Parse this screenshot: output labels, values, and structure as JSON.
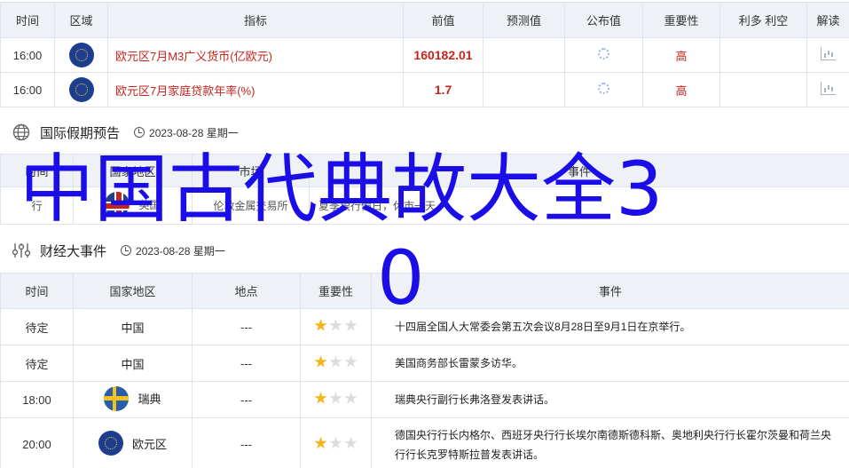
{
  "eco": {
    "headers": [
      "时间",
      "区域",
      "指标",
      "前值",
      "预测值",
      "公布值",
      "重要性",
      "利多 利空",
      "解读"
    ],
    "rows": [
      {
        "time": "16:00",
        "region_flag": "eu",
        "indicator": "欧元区7月M3广义货币(亿欧元)",
        "previous": "160182.01",
        "forecast": "",
        "actual_icon": "loading-icon",
        "importance": "高",
        "impact": "",
        "interp_icon": "chart-icon"
      },
      {
        "time": "16:00",
        "region_flag": "eu",
        "indicator": "欧元区7月家庭贷款年率(%)",
        "previous": "1.7",
        "forecast": "",
        "actual_icon": "loading-icon",
        "importance": "高",
        "impact": "",
        "interp_icon": "chart-icon"
      }
    ]
  },
  "holiday": {
    "title": "国际假期预告",
    "date": "2023-08-28 星期一",
    "headers": [
      "时间",
      "国家地区",
      "市场",
      "事件"
    ],
    "row": {
      "time": "行",
      "country": "英国",
      "market": "伦敦金属交易所",
      "event": "夏季银行假日，休市一天"
    }
  },
  "events": {
    "title": "财经大事件",
    "date": "2023-08-28 星期一",
    "headers": [
      "时间",
      "国家地区",
      "地点",
      "重要性",
      "事件"
    ],
    "rows": [
      {
        "time": "待定",
        "flag": "",
        "country": "中国",
        "location": "---",
        "stars": 1,
        "event": "十四届全国人大常委会第五次会议8月28日至9月1日在京举行。"
      },
      {
        "time": "待定",
        "flag": "",
        "country": "中国",
        "location": "---",
        "stars": 1,
        "event": "美国商务部长雷蒙多访华。"
      },
      {
        "time": "18:00",
        "flag": "se",
        "country": "瑞典",
        "location": "---",
        "stars": 1,
        "event": "瑞典央行副行长弗洛登发表讲话。"
      },
      {
        "time": "20:00",
        "flag": "eu",
        "country": "欧元区",
        "location": "---",
        "stars": 1,
        "event": "德国央行行长内格尔、西班牙央行行长埃尔南德斯德科斯、奥地利央行行长霍尔茨曼和荷兰央行行长克罗特斯拉普发表讲话。"
      }
    ]
  },
  "overlay": {
    "line1": "中国古代典故大全3",
    "line2": "0"
  },
  "colors": {
    "accent_red": "#c8241c",
    "header_bg": "#eef1f6",
    "overlay_blue": "#1a0de8",
    "star_on": "#f3b51c"
  }
}
